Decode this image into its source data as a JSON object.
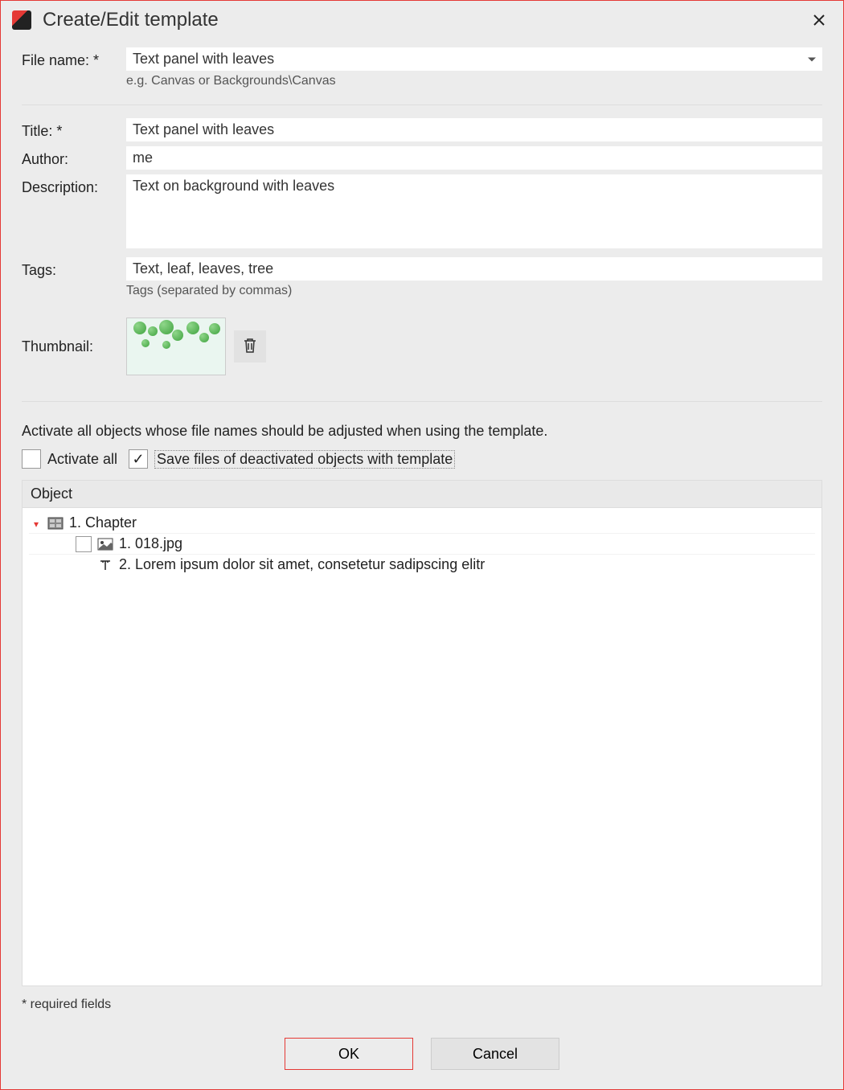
{
  "window": {
    "title": "Create/Edit template"
  },
  "form": {
    "filename_label": "File name: *",
    "filename_value": "Text panel with leaves",
    "filename_hint": "e.g. Canvas or Backgrounds\\Canvas",
    "title_label": "Title: *",
    "title_value": "Text panel with leaves",
    "author_label": "Author:",
    "author_value": "me",
    "description_label": "Description:",
    "description_value": "Text on background with leaves",
    "tags_label": "Tags:",
    "tags_value": "Text, leaf, leaves, tree",
    "tags_hint": "Tags (separated by commas)",
    "thumbnail_label": "Thumbnail:"
  },
  "objects": {
    "instruction": "Activate all objects whose file names should be adjusted when using the template.",
    "activate_all_label": "Activate all",
    "activate_all_checked": false,
    "save_deactivated_label": "Save files of deactivated objects with template",
    "save_deactivated_checked": true,
    "header": "Object",
    "tree": {
      "chapter": "1. Chapter",
      "item1": "1. 018.jpg",
      "item2": "2. Lorem ipsum dolor sit amet, consetetur sadipscing elitr"
    }
  },
  "footer": {
    "required_note": "* required fields",
    "ok": "OK",
    "cancel": "Cancel"
  }
}
